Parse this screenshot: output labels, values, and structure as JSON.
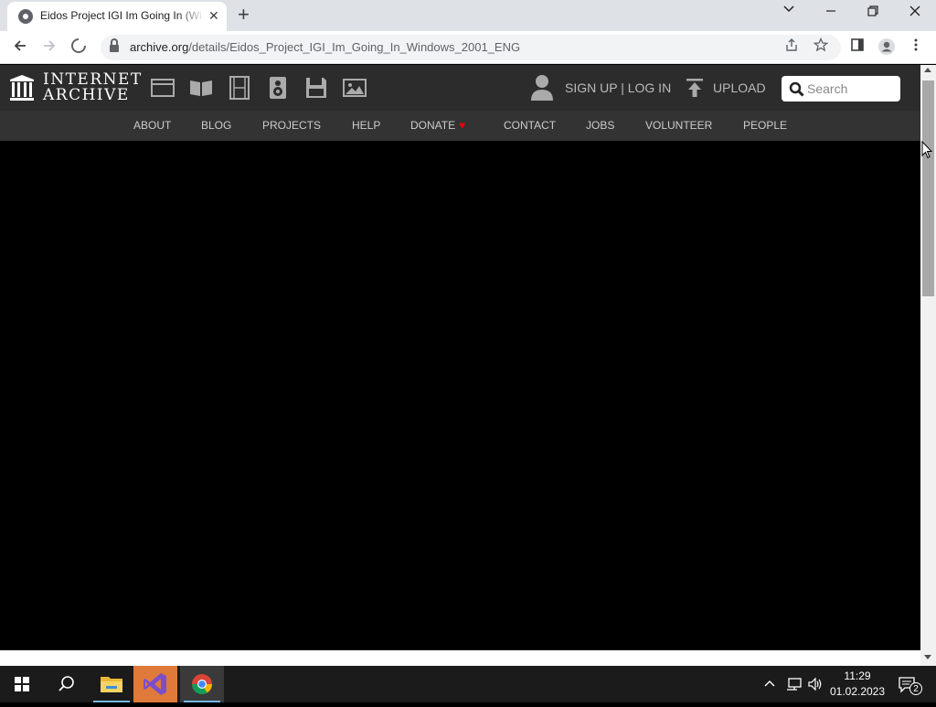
{
  "browser": {
    "tab_title": "Eidos Project IGI Im Going In (Wi",
    "tab_close": "✕",
    "new_tab": "+",
    "url_host": "archive.org",
    "url_path": "/details/Eidos_Project_IGI_Im_Going_In_Windows_2001_ENG",
    "icons": [
      "back-icon",
      "forward-icon",
      "stop-loading-icon",
      "lock-icon",
      "share-icon",
      "bookmark-star-icon",
      "side-panel-icon",
      "profile-icon",
      "menu-icon"
    ],
    "window_controls": {
      "tablist": "⌄",
      "minimize": "—",
      "restore": "❐",
      "close": "✕"
    }
  },
  "ia_header": {
    "logo_line1": "INTERNET",
    "logo_line2": "ARCHIVE",
    "media_icons": [
      "web-icon",
      "texts-icon",
      "video-icon",
      "audio-icon",
      "software-icon",
      "images-icon"
    ],
    "signup_label": "SIGN UP | LOG IN",
    "upload_label": "UPLOAD",
    "search_placeholder": "Search"
  },
  "ia_nav": {
    "items": [
      "ABOUT",
      "BLOG",
      "PROJECTS",
      "HELP",
      "DONATE",
      "CONTACT",
      "JOBS",
      "VOLUNTEER",
      "PEOPLE"
    ],
    "donate_heart": "♥"
  },
  "taskbar": {
    "apps": [
      "file-explorer",
      "visual-studio",
      "chrome"
    ],
    "tray_chevron": "^",
    "time": "11:29",
    "date": "01.02.2023",
    "notification_count": "2"
  },
  "colors": {
    "ia_header_bg": "#2c2c2c",
    "ia_nav_bg": "#333333",
    "donate_heart": "#e00000",
    "taskbar_bg": "#1b1b1b"
  }
}
